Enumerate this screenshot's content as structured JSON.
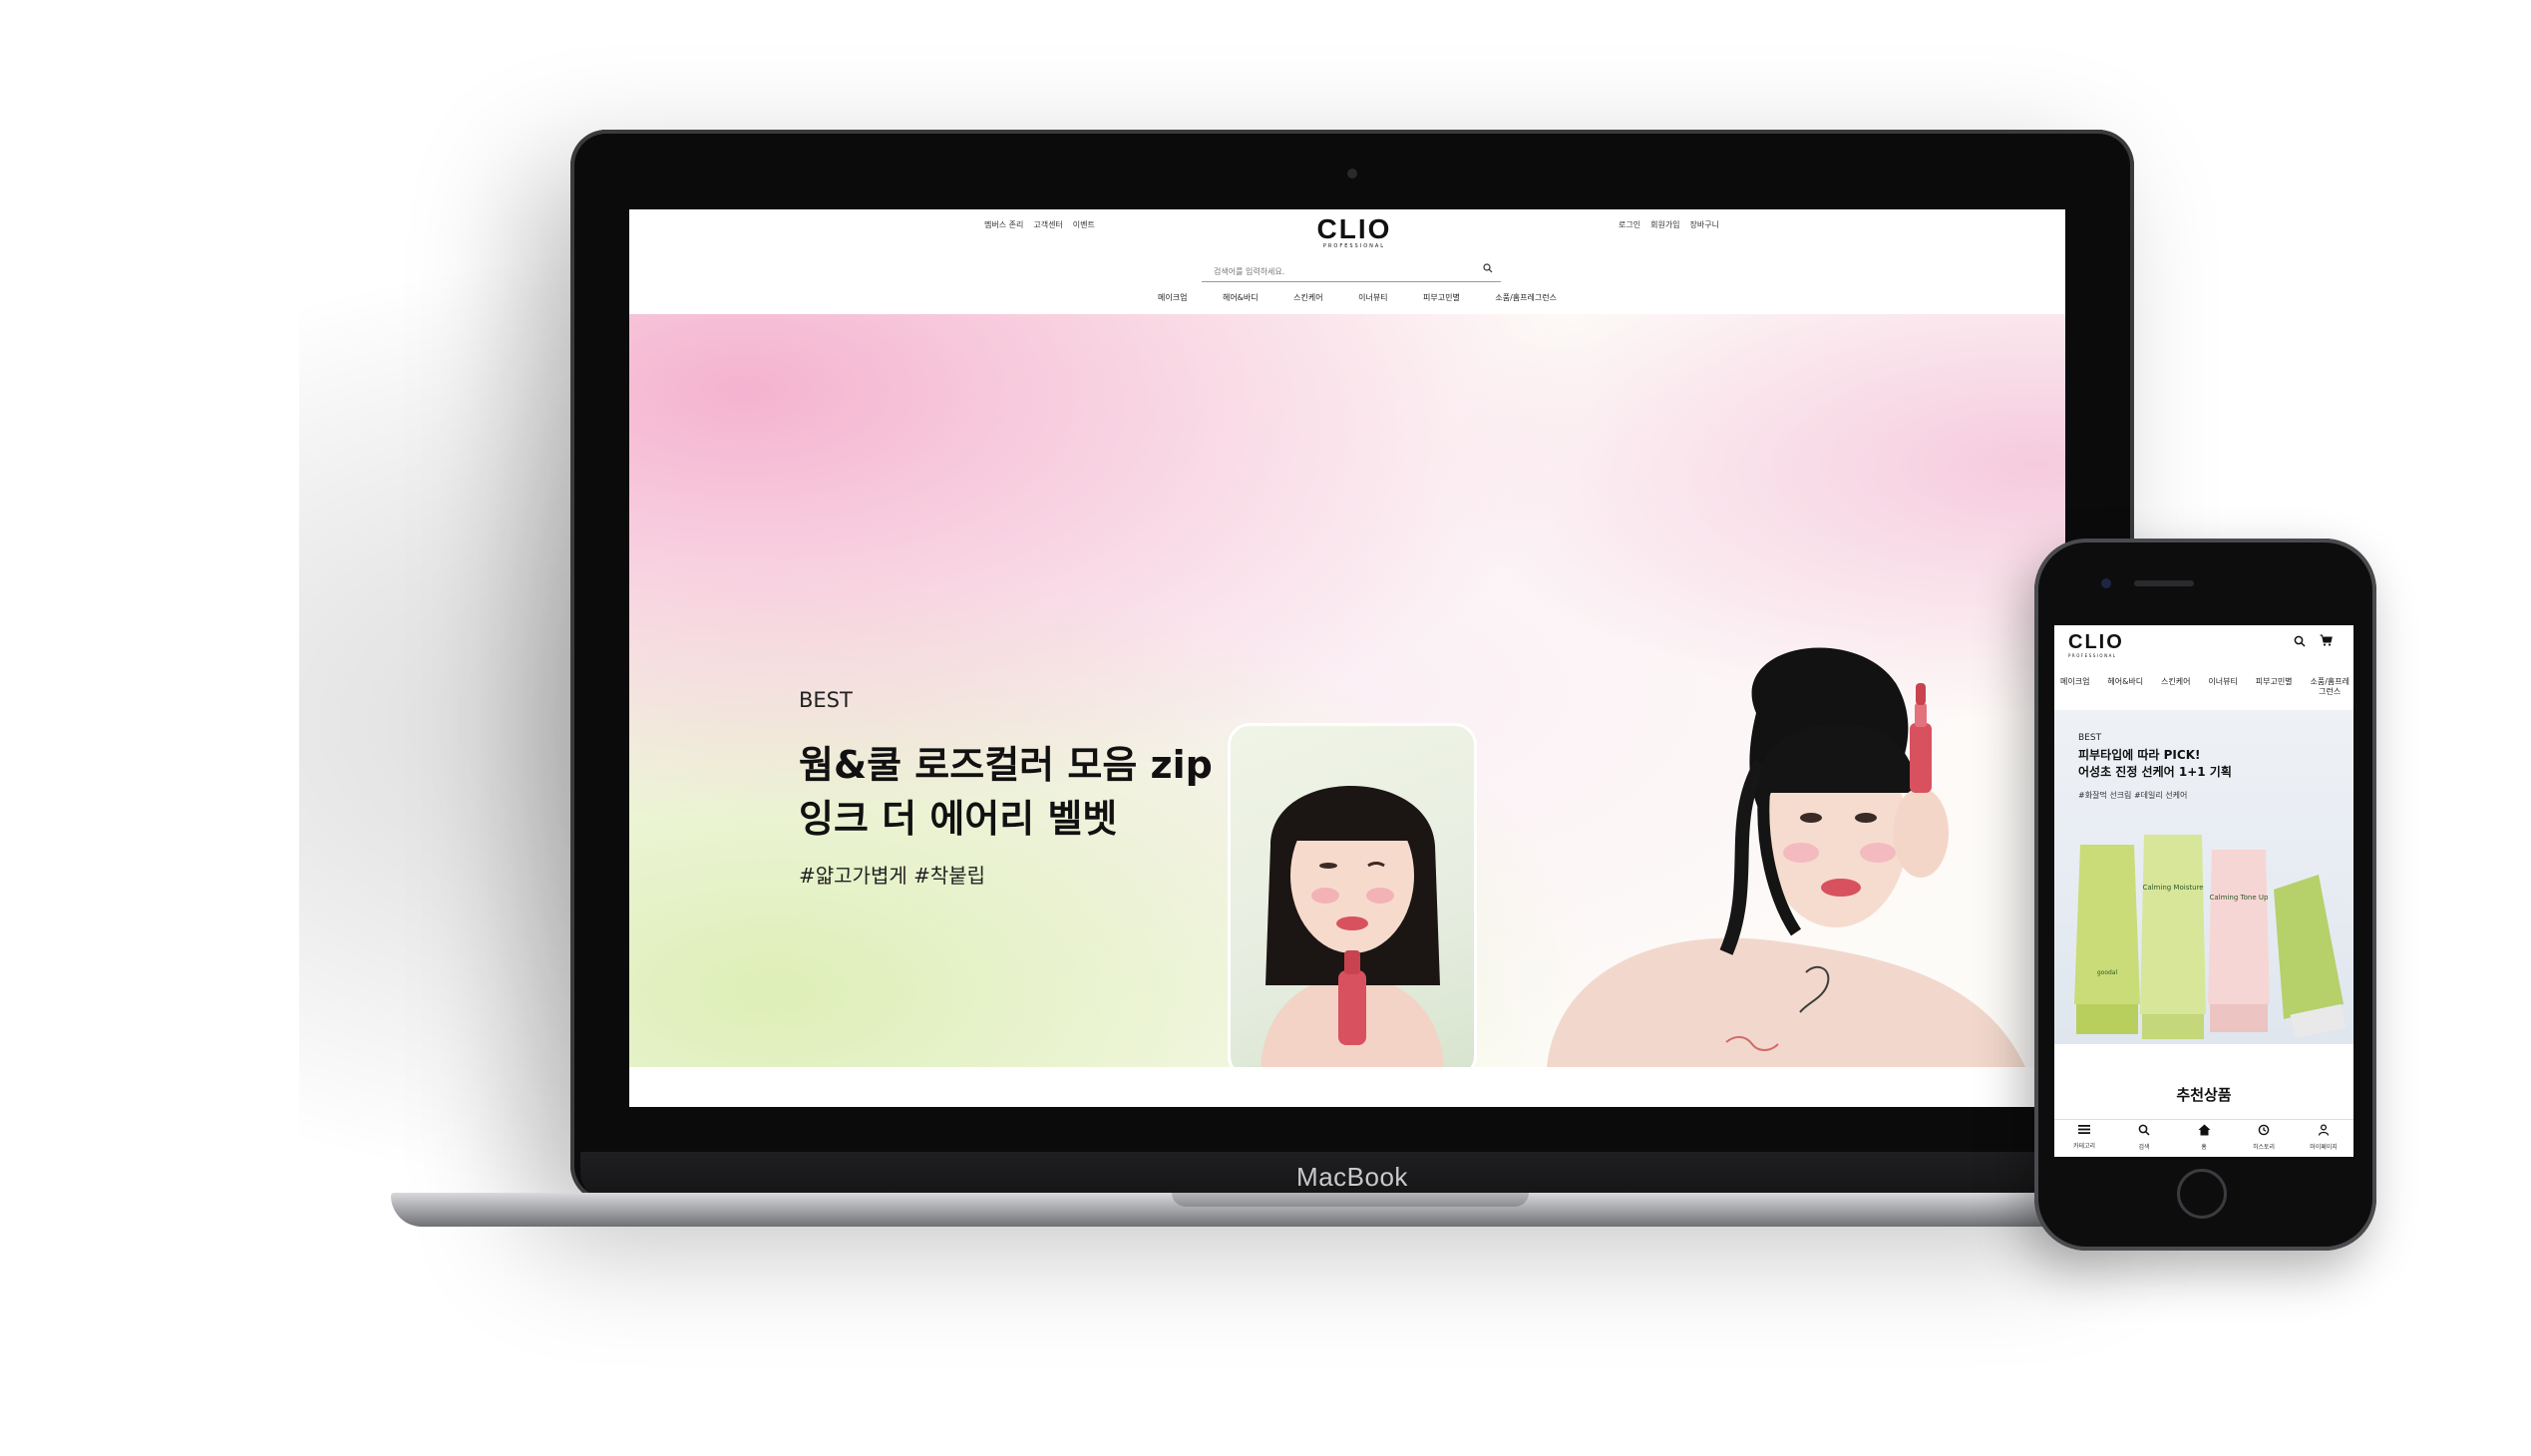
{
  "laptop": {
    "device_label": "MacBook",
    "site": {
      "top_left_links": [
        "멤버스 존리",
        "고객센터",
        "이벤트"
      ],
      "top_right_links": [
        "로그인",
        "회원가입",
        "장바구니"
      ],
      "logo": "CLIO",
      "logo_sub": "PROFESSIONAL",
      "search": {
        "placeholder": "검색어를 입력하세요.",
        "icon": "search-icon"
      },
      "nav": [
        "메이크업",
        "헤어&바디",
        "스킨케어",
        "이너뷰티",
        "피부고민별",
        "소품/홈프레그런스"
      ],
      "hero": {
        "eyebrow": "BEST",
        "title_line1": "웜&쿨 로즈컬러 모음 zip",
        "title_line2": "잉크 더 에어리 벨벳",
        "tags": "#얇고가볍게 #착붙립"
      }
    }
  },
  "phone": {
    "site": {
      "logo": "CLIO",
      "logo_sub": "PROFESSIONAL",
      "header_icons": [
        "search-icon",
        "cart-icon"
      ],
      "nav": [
        "메이크업",
        "헤어&바디",
        "스킨케어",
        "이너뷰티",
        "피부고민별",
        "소품/홈프레\n그런스"
      ],
      "hero": {
        "eyebrow": "BEST",
        "title_line1": "피부타입에 따라 PICK!",
        "title_line2": "어성초 진정 선케어 1+1 기획",
        "tags": "#화잘먹 선크림 #데일리 선케어",
        "product_texts": [
          "goodal",
          "Calming Moisture",
          "Calming Tone Up"
        ]
      },
      "section_title": "추천상품",
      "tabbar": [
        {
          "label": "카테고리",
          "icon": "menu-icon"
        },
        {
          "label": "검색",
          "icon": "search-icon"
        },
        {
          "label": "홈",
          "icon": "home-icon"
        },
        {
          "label": "히스토리",
          "icon": "history-icon"
        },
        {
          "label": "마이페이지",
          "icon": "user-icon"
        }
      ]
    }
  },
  "colors": {
    "hero_pink": "#f4afcd",
    "hero_green": "#dceeb4",
    "lipstick": "#d8515f",
    "device_black": "#0b0b0c"
  }
}
